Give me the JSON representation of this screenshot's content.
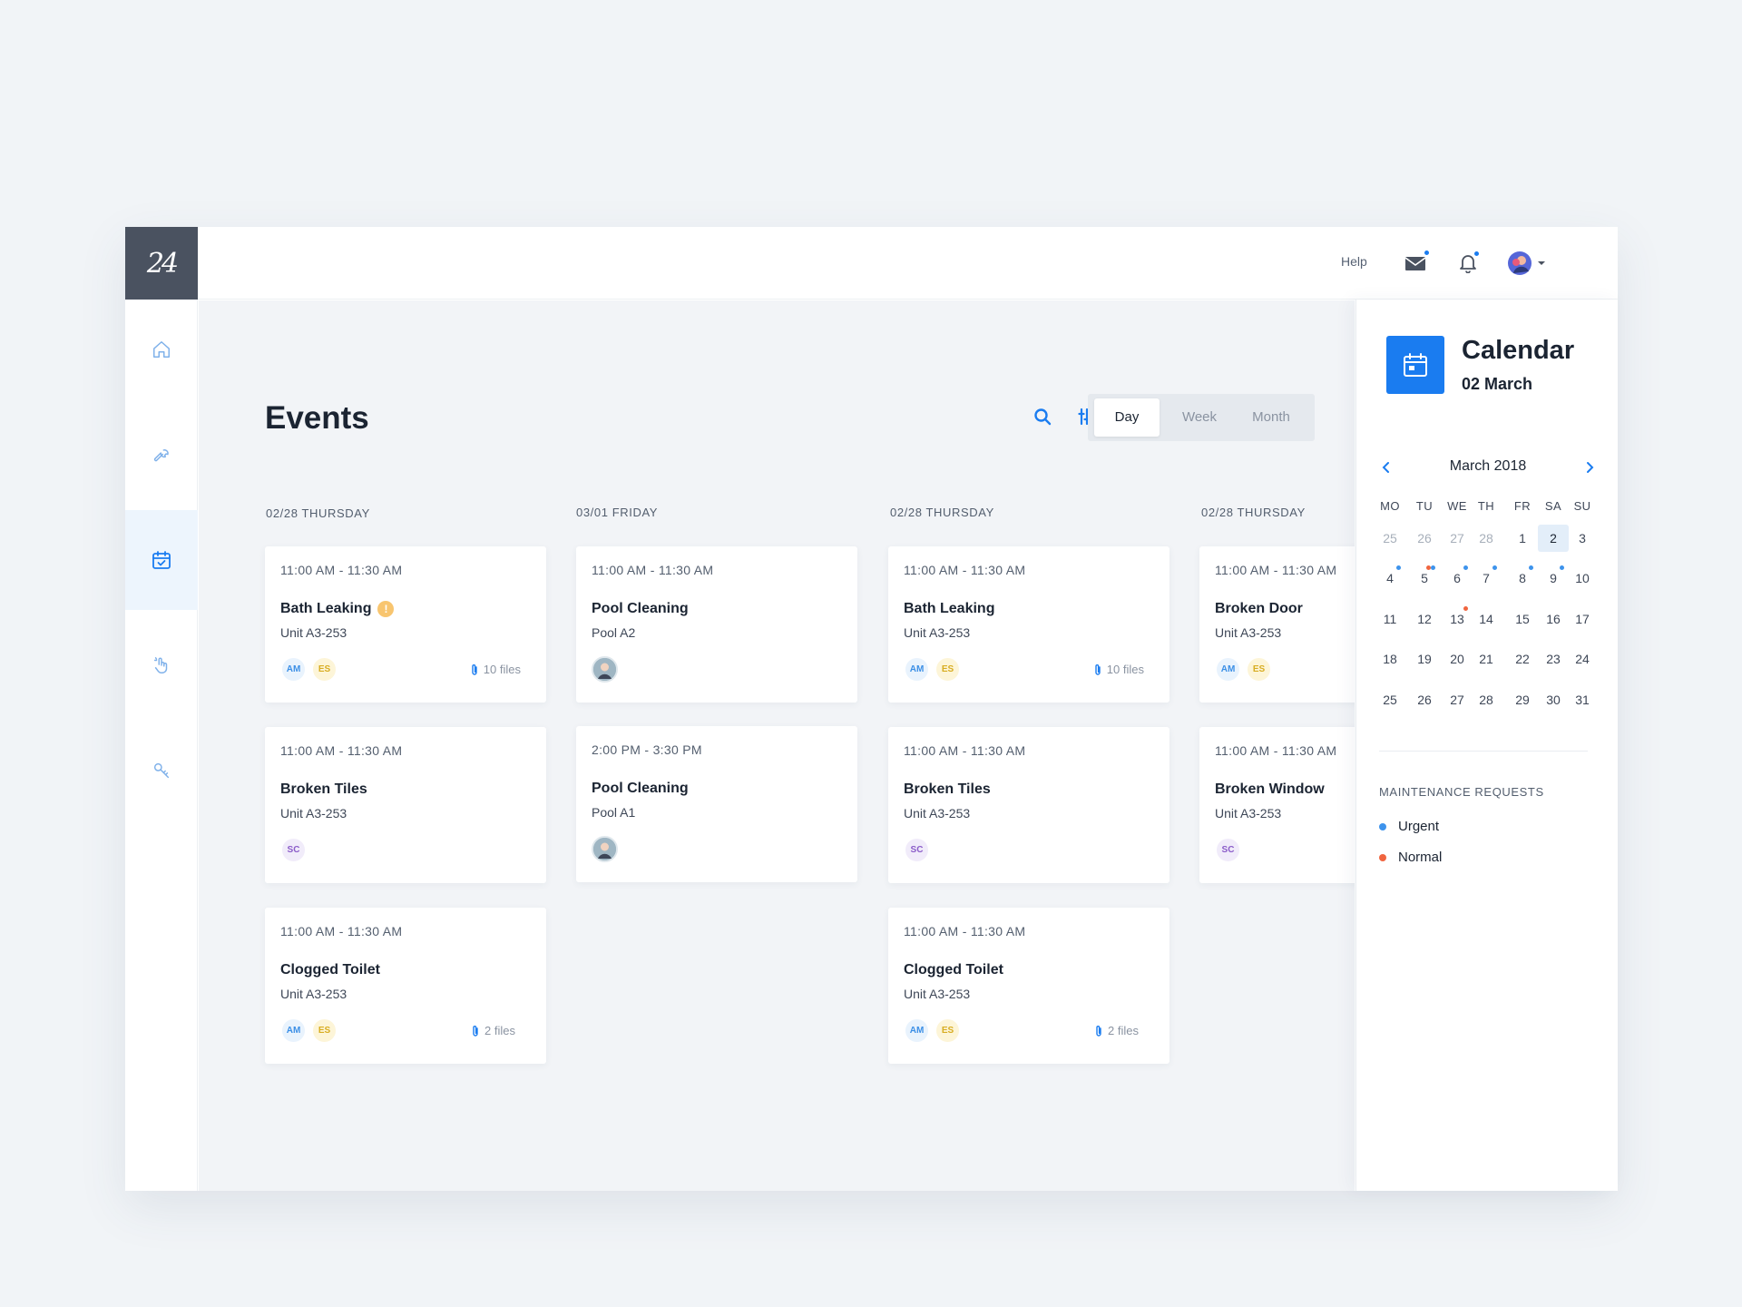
{
  "logo": {
    "text": "24"
  },
  "topbar": {
    "help_label": "Help"
  },
  "page": {
    "title": "Events"
  },
  "view_toggle": {
    "day": "Day",
    "week": "Week",
    "month": "Month",
    "selected": "Day"
  },
  "columns": [
    {
      "header": "02/28 THURSDAY",
      "cards": [
        {
          "time": "11:00 AM - 11:30 AM",
          "title": "Bath Leaking",
          "sub": "Unit A3-253",
          "warning": "!",
          "avatars": [
            "AM",
            "ES"
          ],
          "files": "10 files"
        },
        {
          "time": "11:00 AM - 11:30 AM",
          "title": "Broken Tiles",
          "sub": "Unit A3-253",
          "avatars": [
            "SC"
          ]
        },
        {
          "time": "11:00 AM - 11:30 AM",
          "title": "Clogged Toilet",
          "sub": "Unit A3-253",
          "avatars": [
            "AM",
            "ES"
          ],
          "files": "2 files"
        }
      ]
    },
    {
      "header": "03/01 FRIDAY",
      "cards": [
        {
          "time": "11:00 AM - 11:30 AM",
          "title": "Pool Cleaning",
          "sub": "Pool A2"
        },
        {
          "time": "2:00 PM - 3:30 PM",
          "title": "Pool Cleaning",
          "sub": "Pool A1"
        }
      ]
    },
    {
      "header": "02/28 THURSDAY",
      "cards": [
        {
          "time": "11:00 AM - 11:30 AM",
          "title": "Bath Leaking",
          "sub": "Unit A3-253",
          "avatars": [
            "AM",
            "ES"
          ],
          "files": "10 files"
        },
        {
          "time": "11:00 AM - 11:30 AM",
          "title": "Broken Tiles",
          "sub": "Unit A3-253",
          "avatars": [
            "SC"
          ]
        },
        {
          "time": "11:00 AM - 11:30 AM",
          "title": "Clogged Toilet",
          "sub": "Unit A3-253",
          "avatars": [
            "AM",
            "ES"
          ],
          "files": "2 files"
        }
      ]
    },
    {
      "header": "02/28 THURSDAY",
      "cards": [
        {
          "time": "11:00 AM - 11:30 AM",
          "title": "Broken Door",
          "sub": "Unit A3-253",
          "avatars": [
            "AM",
            "ES"
          ]
        },
        {
          "time": "11:00 AM - 11:30 AM",
          "title": "Broken Window",
          "sub": "Unit A3-253",
          "avatars": [
            "SC"
          ]
        }
      ]
    }
  ],
  "calendar": {
    "title": "Calendar",
    "date": "02 March",
    "month_label": "March 2018",
    "weekdays": [
      "MO",
      "TU",
      "WE",
      "TH",
      "FR",
      "SA",
      "SU"
    ],
    "rows": [
      [
        "25",
        "26",
        "27",
        "28",
        "1",
        "2",
        "3"
      ],
      [
        "4",
        "5",
        "6",
        "7",
        "8",
        "9",
        "10"
      ],
      [
        "11",
        "12",
        "13",
        "14",
        "15",
        "16",
        "17"
      ],
      [
        "18",
        "19",
        "20",
        "21",
        "22",
        "23",
        "24"
      ],
      [
        "25",
        "26",
        "27",
        "28",
        "29",
        "30",
        "31"
      ]
    ],
    "selected_day": "2"
  },
  "legend": {
    "title": "MAINTENANCE REQUESTS",
    "items": [
      {
        "label": "Urgent",
        "color": "#3d93ec"
      },
      {
        "label": "Normal",
        "color": "#f0653f"
      }
    ]
  },
  "colors": {
    "accent": "#1a7cf0",
    "sidebar_dark": "#4a5260",
    "warning": "#f8c56f"
  },
  "scroll": {
    "position": 0.1
  }
}
